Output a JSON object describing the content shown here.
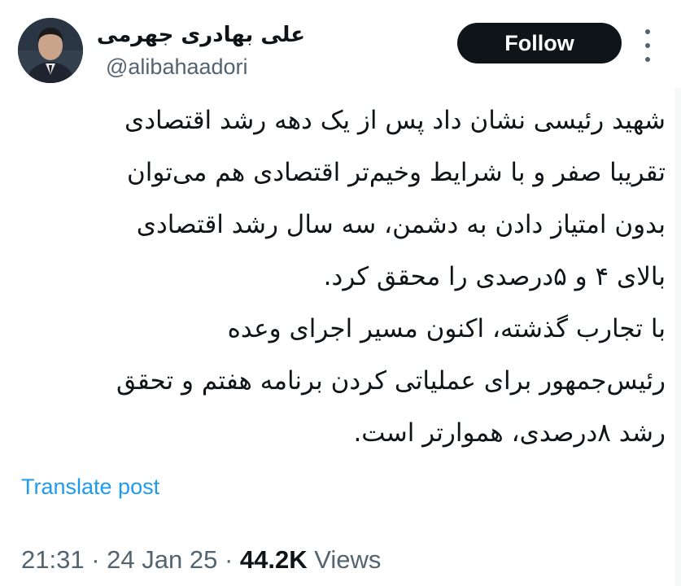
{
  "author": {
    "display_name": "علی بهادری جهرمی",
    "handle": "@alibahaadori"
  },
  "follow_button": {
    "label": "Follow"
  },
  "more_menu": {
    "icon": "more-vertical-icon"
  },
  "tweet": {
    "lines": [
      "شهید رئیسی نشان داد پس از یک دهه رشد اقتصادی",
      "تقریبا صفر و با شرایط وخیم‌تر اقتصادی هم می‌توان",
      "بدون امتیاز دادن به دشمن، سه سال رشد اقتصادی",
      "بالای ۴ و ۵درصدی را محقق کرد.",
      "با تجارب گذشته، اکنون مسیر اجرای وعده",
      "رئیس‌جمهور برای عملیاتی کردن برنامه هفتم و تحقق",
      "رشد ۸درصدی، هموارتر است."
    ]
  },
  "translate": {
    "label": "Translate post"
  },
  "meta": {
    "time": "21:31",
    "separator": "·",
    "date": "24 Jan 25",
    "views_count": "44.2K",
    "views_label": "Views"
  },
  "colors": {
    "text": "#0f1419",
    "secondary": "#536471",
    "link": "#1d9bf0",
    "follow_bg": "#0f1419"
  }
}
